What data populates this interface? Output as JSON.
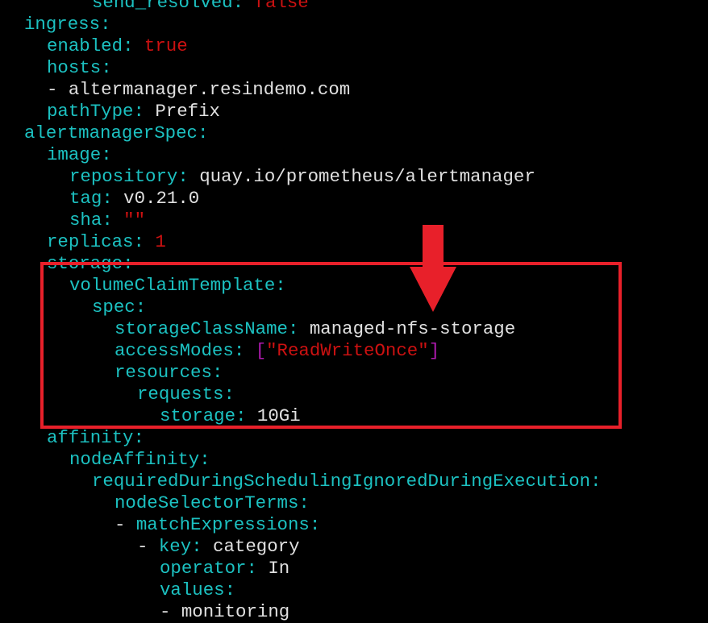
{
  "lines": [
    {
      "i": 3,
      "key": "send_resolved",
      "colon": ":",
      "val": " false",
      "vt": "b"
    },
    {
      "i": 0,
      "key": "ingress",
      "colon": ":"
    },
    {
      "i": 1,
      "key": "enabled",
      "colon": ":",
      "val": " true",
      "vt": "b"
    },
    {
      "i": 1,
      "key": "hosts",
      "colon": ":"
    },
    {
      "i": 1,
      "dash": "- ",
      "val": "altermanager.resindemo.com",
      "vt": "v"
    },
    {
      "i": 1,
      "key": "pathType",
      "colon": ":",
      "val": " Prefix",
      "vt": "v"
    },
    {
      "i": 0,
      "key": "alertmanagerSpec",
      "colon": ":"
    },
    {
      "i": 1,
      "key": "image",
      "colon": ":"
    },
    {
      "i": 2,
      "key": "repository",
      "colon": ":",
      "val": " quay.io/prometheus/alertmanager",
      "vt": "v"
    },
    {
      "i": 2,
      "key": "tag",
      "colon": ":",
      "val": " v0.21.0",
      "vt": "v"
    },
    {
      "i": 2,
      "key": "sha",
      "colon": ":",
      "val": " \"\"",
      "vt": "s"
    },
    {
      "i": 1,
      "key": "replicas",
      "colon": ":",
      "val": " 1",
      "vt": "b"
    },
    {
      "i": 1,
      "key": "storage",
      "colon": ":"
    },
    {
      "i": 2,
      "key": "volumeClaimTemplate",
      "colon": ":"
    },
    {
      "i": 3,
      "key": "spec",
      "colon": ":"
    },
    {
      "i": 4,
      "key": "storageClassName",
      "colon": ":",
      "val": " managed-nfs-storage",
      "vt": "v"
    },
    {
      "i": 4,
      "key": "accessModes",
      "colon": ":",
      "arr": true,
      "arr_open": "[",
      "arr_val": "\"ReadWriteOnce\"",
      "arr_close": "]"
    },
    {
      "i": 4,
      "key": "resources",
      "colon": ":"
    },
    {
      "i": 5,
      "key": "requests",
      "colon": ":"
    },
    {
      "i": 6,
      "key": "storage",
      "colon": ":",
      "val": " 10Gi",
      "vt": "v"
    },
    {
      "i": 1,
      "key": "affinity",
      "colon": ":"
    },
    {
      "i": 2,
      "key": "nodeAffinity",
      "colon": ":"
    },
    {
      "i": 3,
      "key": "requiredDuringSchedulingIgnoredDuringExecution",
      "colon": ":"
    },
    {
      "i": 4,
      "key": "nodeSelectorTerms",
      "colon": ":"
    },
    {
      "i": 4,
      "dash": "- ",
      "key": "matchExpressions",
      "colon": ":"
    },
    {
      "i": 5,
      "dash": "- ",
      "key": "key",
      "colon": ":",
      "val": " category",
      "vt": "v"
    },
    {
      "i": 6,
      "key": "operator",
      "colon": ":",
      "val": " In",
      "vt": "v"
    },
    {
      "i": 6,
      "key": "values",
      "colon": ":"
    },
    {
      "i": 6,
      "dash": "- ",
      "val": "monitoring",
      "vt": "v"
    }
  ],
  "colors": {
    "background": "#000000",
    "key": "#1cc1c1",
    "value": "#e0e0e0",
    "literal": "#cc1111",
    "bracket": "#b01ab0",
    "highlight": "#e8202a"
  },
  "annotations": {
    "box_icon": "highlight-box",
    "arrow_icon": "down-arrow-icon"
  }
}
